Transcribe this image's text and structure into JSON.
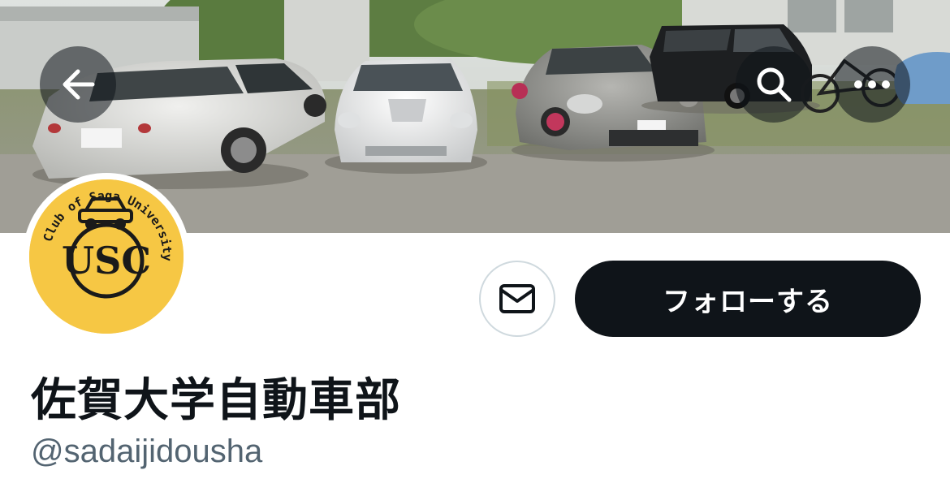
{
  "banner": {
    "description_icon": "banner-photo"
  },
  "header": {
    "back_icon": "arrow-left-icon",
    "search_icon": "search-icon",
    "more_icon": "more-horizontal-icon"
  },
  "avatar": {
    "logo_text_top": "Car",
    "logo_text_ring": "Club of Saga University",
    "logo_letters": "USC"
  },
  "actions": {
    "message_icon": "envelope-icon",
    "follow_label": "フォローする"
  },
  "profile": {
    "display_name": "佐賀大学自動車部",
    "handle": "@sadaijidousha"
  },
  "colors": {
    "follow_bg": "#0f1419",
    "handle_text": "#536471",
    "avatar_bg": "#f6c744",
    "border": "#cfd9de"
  }
}
